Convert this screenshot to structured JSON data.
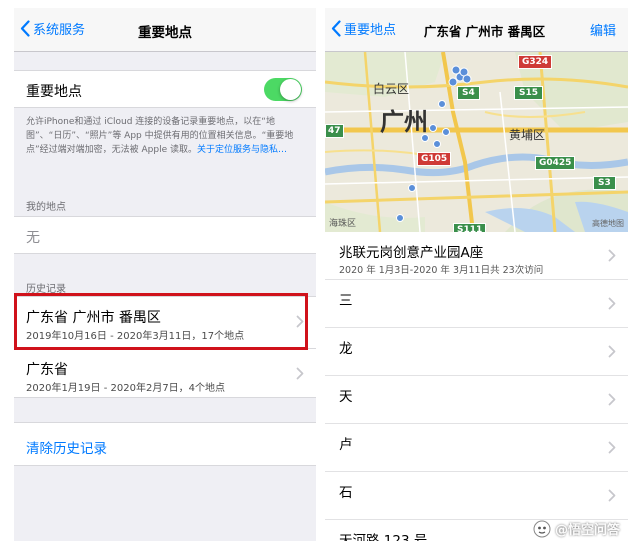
{
  "left": {
    "nav": {
      "back_label": "系统服务",
      "title": "重要地点"
    },
    "toggle_row": {
      "label": "重要地点",
      "enabled": true
    },
    "description": {
      "text": "允许iPhone和通过 iCloud 连接的设备记录重要地点，以在“地图”、“日历”、“照片”等 App 中提供有用的位置相关信息。“重要地点”经过端对端加密，无法被 Apple 读取。",
      "link": "关于定位服务与隐私…"
    },
    "my_places": {
      "header": "我的地点",
      "value": "无"
    },
    "history": {
      "header": "历史记录",
      "items": [
        {
          "title": "广东省 广州市 番禺区",
          "subtitle": "2019年10月16日 - 2020年3月11日，17个地点"
        },
        {
          "title": "广东省",
          "subtitle": "2020年1月19日 - 2020年2月7日，4个地点"
        }
      ]
    },
    "clear_label": "清除历史记录"
  },
  "right": {
    "nav": {
      "back_label": "重要地点",
      "title": "广东省 广州市 番禺区",
      "edit_label": "编辑"
    },
    "map": {
      "labels": {
        "baiyun": "白云区",
        "guangzhou": "广州",
        "huangpu": "黄埔区",
        "haizhu": "海珠区"
      },
      "shields": [
        "G324",
        "S4",
        "S15",
        "G105",
        "G0425",
        "S3",
        "47",
        "S111"
      ],
      "attribution": "高德地图"
    },
    "list": [
      {
        "title": "兆联元岗创意产业园A座",
        "subtitle": "2020 年 1月3日-2020 年 3月11日共 23次访问"
      },
      {
        "title": "三",
        "subtitle": ""
      },
      {
        "title": "龙",
        "subtitle": ""
      },
      {
        "title": "天",
        "subtitle": ""
      },
      {
        "title": "卢",
        "subtitle": ""
      },
      {
        "title": "石",
        "subtitle": ""
      },
      {
        "title": "天河路 123 号",
        "subtitle": ""
      }
    ]
  },
  "watermark": {
    "text": "@悟空问答",
    "icon": "wukong-logo-icon"
  },
  "colors": {
    "accent": "#007aff",
    "toggle_on": "#4cd964",
    "highlight": "#d0121b",
    "highway_green": "#3a8f4b",
    "national_red": "#cf3a36"
  }
}
